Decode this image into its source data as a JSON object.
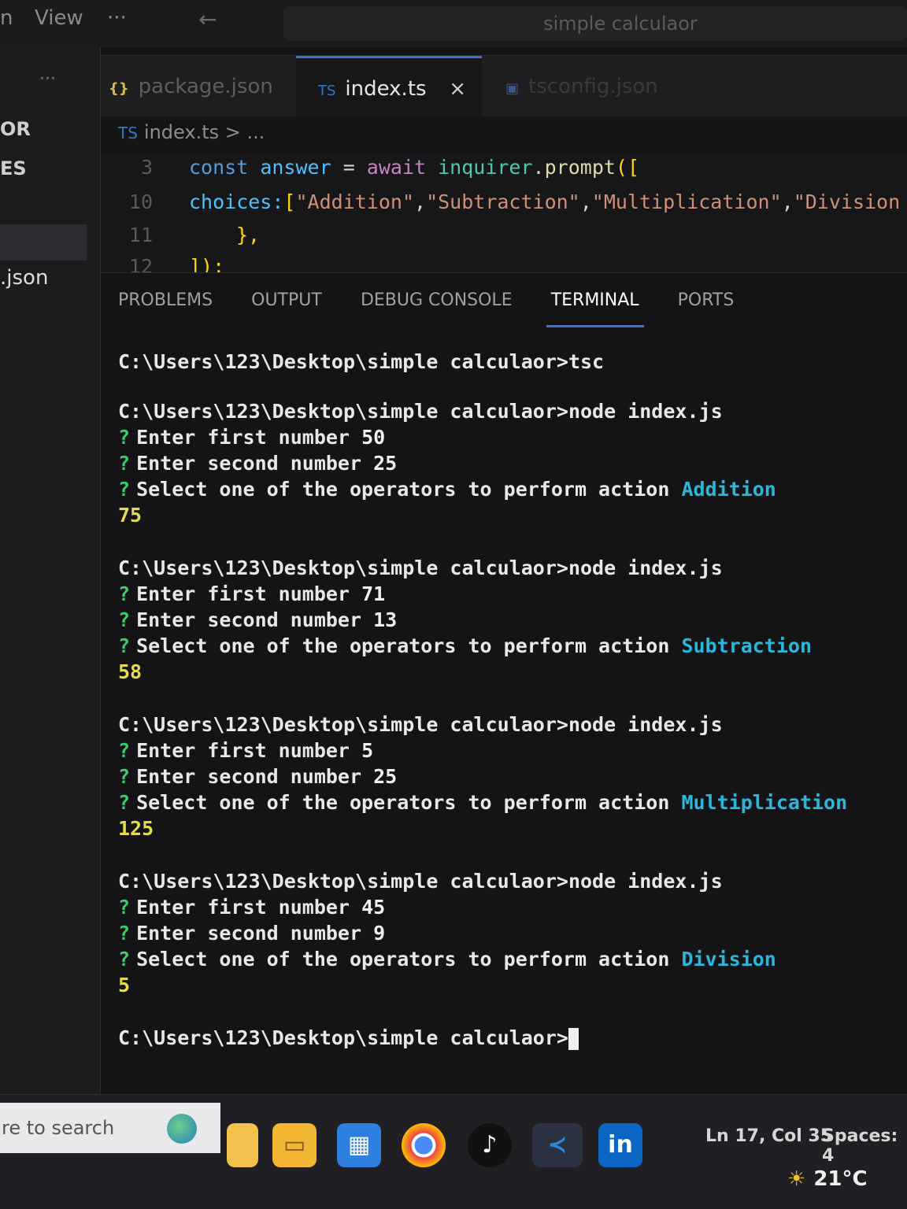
{
  "titlebar": {
    "menu_partial": "n",
    "menu_view": "View",
    "menu_more": "···",
    "back_icon": "arrow-left",
    "search_text": "simple calculaor"
  },
  "tabs": [
    {
      "badge": "{}",
      "label": "package.json",
      "active": false
    },
    {
      "badge": "TS",
      "label": "index.ts",
      "active": true,
      "close": "×"
    },
    {
      "badge": "",
      "label": "tsconfig.json",
      "active": false
    }
  ],
  "sidebar": {
    "more": "···",
    "label_or": "OR",
    "label_es": "ES",
    "file_json": ".json"
  },
  "breadcrumb": {
    "file": "index.ts",
    "sep": ">",
    "rest": "..."
  },
  "editor": {
    "lines": [
      {
        "num": "3",
        "kw": "const",
        "var": "answer",
        "op": " = ",
        "aw": "await",
        "obj": "inquirer",
        "dot": ".",
        "fn": "prompt",
        "br": "(["
      },
      {
        "num": "10",
        "text_key": "choices:",
        "bracket": "[",
        "strings": [
          "\"Addition\"",
          "\"Subtraction\"",
          "\"Multiplication\"",
          "\"Division"
        ]
      },
      {
        "num": "11",
        "text": "},"
      },
      {
        "num": "12",
        "text": "]);"
      }
    ]
  },
  "panel": {
    "tabs": [
      "PROBLEMS",
      "OUTPUT",
      "DEBUG CONSOLE",
      "TERMINAL",
      "PORTS"
    ],
    "active_tab": "TERMINAL"
  },
  "terminal": {
    "prompt": "C:\\Users\\123\\Desktop\\simple calculaor>",
    "first_cmd": "tsc",
    "run_cmd": "node index.js",
    "q1": "Enter first number",
    "q2": "Enter second number",
    "q3": "Select one of the operators to perform action",
    "runs": [
      {
        "a": "50",
        "b": "25",
        "op": "Addition",
        "result": "75"
      },
      {
        "a": "71",
        "b": "13",
        "op": "Subtraction",
        "result": "58"
      },
      {
        "a": "5",
        "b": "25",
        "op": "Multiplication",
        "result": "125"
      },
      {
        "a": "45",
        "b": "9",
        "op": "Division",
        "result": "5"
      }
    ],
    "qmark": "?"
  },
  "taskbar": {
    "search_placeholder": "re to search",
    "status_position": "Ln 17, Col 35",
    "status_spaces": "Spaces: 4",
    "temperature": "21°C",
    "linkedin": "in",
    "colors": {
      "vscode": "#2d86d6",
      "linkedin": "#0a66c2",
      "store": "#2f7fe0",
      "explorer": "#f2b632"
    }
  }
}
